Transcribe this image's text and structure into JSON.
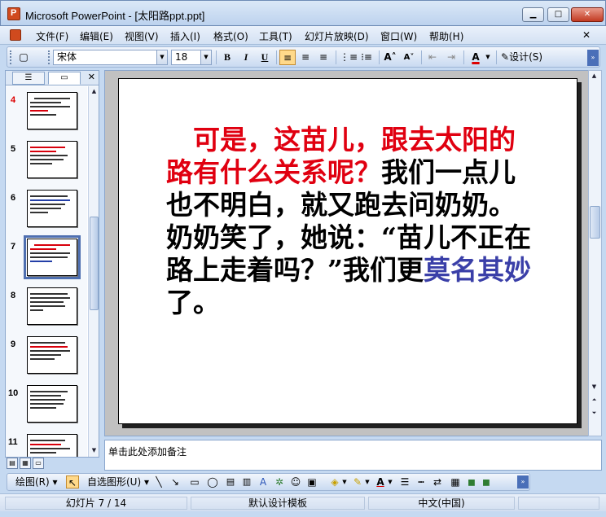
{
  "window": {
    "title": "Microsoft PowerPoint - [太阳路ppt.ppt]",
    "minimize": "▁",
    "maximize": "□",
    "close": "✕"
  },
  "menu": {
    "items": [
      "文件(F)",
      "编辑(E)",
      "视图(V)",
      "插入(I)",
      "格式(O)",
      "工具(T)",
      "幻灯片放映(D)",
      "窗口(W)",
      "帮助(H)"
    ],
    "close": "✕"
  },
  "toolbar": {
    "font_name": "宋体",
    "font_size": "18",
    "bold": "B",
    "italic": "I",
    "underline": "U",
    "font_color": "A",
    "design": "设计(S)",
    "icons": [
      "new-slide-icon",
      "align-left-icon",
      "align-center-icon",
      "align-right-icon",
      "numbered-list-icon",
      "bullet-list-icon",
      "increase-font-icon",
      "decrease-font-icon",
      "decrease-indent-icon",
      "increase-indent-icon",
      "font-color-icon",
      "design-icon"
    ]
  },
  "left_panel": {
    "tabs": [
      "outline-icon",
      "slides-icon"
    ],
    "close": "✕",
    "thumbnails": [
      {
        "number": "4",
        "selected": false
      },
      {
        "number": "5",
        "selected": false
      },
      {
        "number": "6",
        "selected": false
      },
      {
        "number": "7",
        "selected": true
      },
      {
        "number": "8",
        "selected": false
      },
      {
        "number": "9",
        "selected": false
      },
      {
        "number": "10",
        "selected": false
      },
      {
        "number": "11",
        "selected": false
      }
    ]
  },
  "slide": {
    "text_red": "可是，这苗儿，跟去太阳的路有什么关系呢？",
    "text_black1": "我们一点儿也不明白，就又跑去问奶奶。奶奶笑了，她说：“苗儿不正在路上走着吗？”我们更",
    "text_blue": "莫名其妙",
    "text_black2": "了。",
    "colors": {
      "red": "#e00010",
      "blue": "#3a3fa8",
      "black": "#000000"
    }
  },
  "notes": {
    "placeholder": "单击此处添加备注"
  },
  "drawbar": {
    "draw": "绘图(R)",
    "autoshapes": "自选图形(U)"
  },
  "status": {
    "slide": "幻灯片 7 / 14",
    "template": "默认设计模板",
    "language": "中文(中国)"
  }
}
